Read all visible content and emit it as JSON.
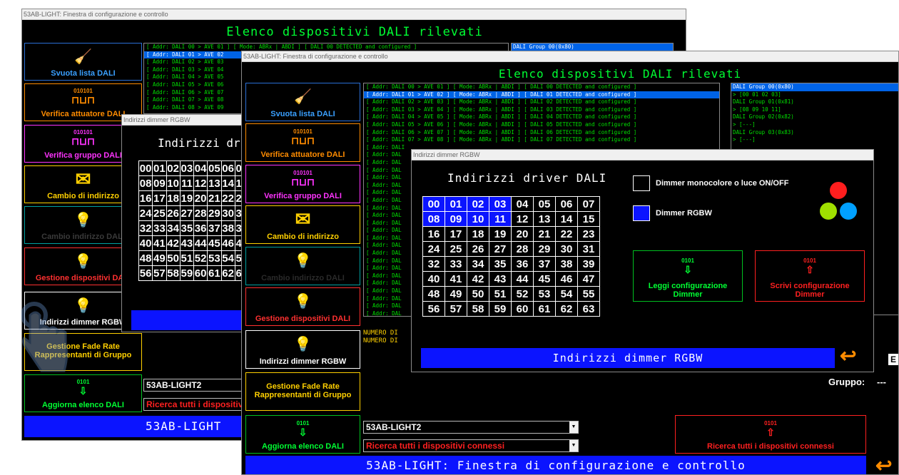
{
  "back_window": {
    "title": "53AB-LIGHT: Finestra di configurazione e controllo",
    "banner": "Elenco dispositivi DALI rilevati",
    "buttons": [
      "Svuota lista DALI",
      "Verifica attuatore DALI",
      "Verifica gruppo DALI",
      "Cambio di indirizzo",
      "Cambio indirizzo DALI",
      "Gestione dispositivi DALI",
      "Indirizzi dimmer RGBW",
      "Gestione Fade Rate Rappresentanti di Gruppo",
      "Aggiorna elenco DALI"
    ],
    "device_lines": [
      "[ Addr: DALI 00 > AVE 01 ] [ Mode: ABRx | ABDI ] [ DALI 00 DETECTED and configured ]",
      "[ Addr: DALI 01 > AVE 02",
      "[ Addr: DALI 02 > AVE 03",
      "[ Addr: DALI 03 > AVE 04",
      "[ Addr: DALI 04 > AVE 05",
      "[ Addr: DALI 05 > AVE 06",
      "[ Addr: DALI 06 > AVE 07",
      "[ Addr: DALI 07 > AVE 08",
      "[ Addr: DALI 08 > AVE 09"
    ],
    "group_line": "DALI Group 00(0x80)",
    "combo_device": "53AB-LIGHT2",
    "combo_search": "Ricerca tutti i dispositivi connessi",
    "bottom_bar": "53AB-LIGHT"
  },
  "mid_dialog": {
    "title": "Indirizzi dimmer RGBW",
    "heading": "Indirizzi driver DALI"
  },
  "front_window": {
    "title": "53AB-LIGHT: Finestra di configurazione e controllo",
    "banner": "Elenco dispositivi DALI rilevati",
    "buttons": [
      "Svuota lista DALI",
      "Verifica attuatore DALI",
      "Verifica gruppo DALI",
      "Cambio di indirizzo",
      "Cambio indirizzo DALI",
      "Gestione dispositivi DALI",
      "Indirizzi dimmer RGBW",
      "Gestione Fade Rate Rappresentanti di Gruppo",
      "Aggiorna elenco DALI"
    ],
    "device_lines": [
      "[ Addr: DALI 00 > AVE 01 ] [ Mode: ABRx | ABDI ] [ DALI 00 DETECTED and configured ]",
      "[ Addr: DALI 01 > AVE 02 ] [ Mode: ABRx | ABDI ] [ DALI 01 DETECTED and configured ]",
      "[ Addr: DALI 02 > AVE 03 ] [ Mode: ABRx | ABDI ] [ DALI 02 DETECTED and configured ]",
      "[ Addr: DALI 03 > AVE 04 ] [ Mode: ABRx | ABDI ] [ DALI 03 DETECTED and configured ]",
      "[ Addr: DALI 04 > AVE 05 ] [ Mode: ABRx | ABDI ] [ DALI 04 DETECTED and configured ]",
      "[ Addr: DALI 05 > AVE 06 ] [ Mode: ABRx | ABDI ] [ DALI 05 DETECTED and configured ]",
      "[ Addr: DALI 06 > AVE 07 ] [ Mode: ABRx | ABDI ] [ DALI 06 DETECTED and configured ]",
      "[ Addr: DALI 07 > AVE 08 ] [ Mode: ABRx | ABDI ] [ DALI 07 DETECTED and configured ]",
      "[ Addr: DALI",
      "[ Addr: DAL",
      "[ Addr: DAL",
      "[ Addr: DAL",
      "[ Addr: DAL",
      "[ Addr: DAL",
      "[ Addr: DAL",
      "[ Addr: DAL",
      "[ Addr: DAL",
      "[ Addr: DAL",
      "[ Addr: DAL",
      "[ Addr: DAL",
      "[ Addr: DAL",
      "[ Addr: DAL",
      "[ Addr: DAL",
      "[ Addr: DAL",
      "[ Addr: DAL",
      "[ Addr: DAL",
      "[ Addr: DAL",
      "[ Addr: DAL",
      "[ Addr: DAL",
      "[ Addr: DAL",
      "[ Addr: DAL",
      "[ Addr: DAL"
    ],
    "group_lines": [
      "DALI Group 00(0x80)",
      " > [00 01 02 03]",
      "DALI Group 01(0x81)",
      " > [08 09 10 11]",
      "DALI Group 02(0x82)",
      " > [---]",
      "DALI Group 03(0x83)",
      " > [---]"
    ],
    "numero_lines": [
      "NUMERO DI",
      "NUMERO DI"
    ],
    "gruppo_label": "Gruppo:",
    "gruppo_value": "---",
    "e_label": "E",
    "combo_device": "53AB-LIGHT2",
    "combo_search": "Ricerca tutti i dispositivi connessi",
    "scan_button": "Ricerca tutti i dispositivi connessi",
    "bottom_bar": "53AB-LIGHT: Finestra di configurazione e controllo"
  },
  "rgbw_dialog": {
    "title": "Indirizzi dimmer RGBW",
    "heading": "Indirizzi driver DALI",
    "legend_mono": "Dimmer monocolore o luce ON/OFF",
    "legend_rgbw": "Dimmer RGBW",
    "read_button": "Leggi configurazione Dimmer",
    "write_button": "Scrivi configurazione Dimmer",
    "bottom_bar": "Indirizzi dimmer RGBW",
    "selected_addresses": [
      "00",
      "01",
      "02",
      "03",
      "08",
      "09",
      "10",
      "11"
    ]
  },
  "addresses": [
    [
      "00",
      "01",
      "02",
      "03",
      "04",
      "05",
      "06",
      "07"
    ],
    [
      "08",
      "09",
      "10",
      "11",
      "12",
      "13",
      "14",
      "15"
    ],
    [
      "16",
      "17",
      "18",
      "19",
      "20",
      "21",
      "22",
      "23"
    ],
    [
      "24",
      "25",
      "26",
      "27",
      "28",
      "29",
      "30",
      "31"
    ],
    [
      "32",
      "33",
      "34",
      "35",
      "36",
      "37",
      "38",
      "39"
    ],
    [
      "40",
      "41",
      "42",
      "43",
      "44",
      "45",
      "46",
      "47"
    ],
    [
      "48",
      "49",
      "50",
      "51",
      "52",
      "53",
      "54",
      "55"
    ],
    [
      "56",
      "57",
      "58",
      "59",
      "60",
      "61",
      "62",
      "63"
    ]
  ],
  "colors": {
    "green": "#00ff33",
    "blue": "#0b14ff",
    "red": "#ff2020",
    "orange": "#ff8c00",
    "magenta": "#ff33ff"
  },
  "icon_label": "0101",
  "icon_bits": "010101"
}
